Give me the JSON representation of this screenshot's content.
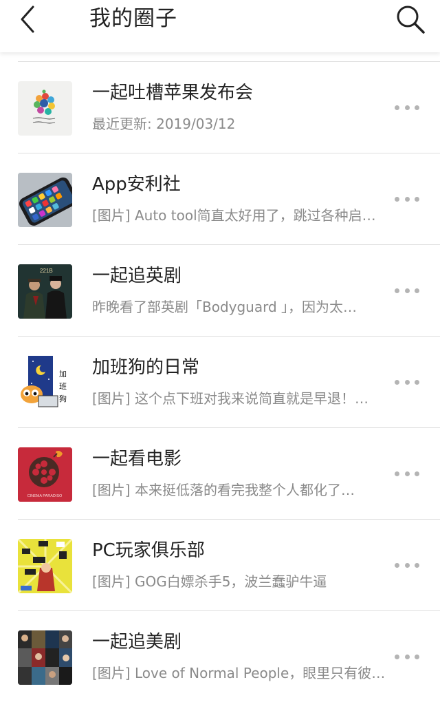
{
  "header": {
    "title": "我的圈子",
    "back_icon": "chevron-left-icon",
    "search_icon": "search-icon"
  },
  "circles": [
    {
      "name": "一起吐槽苹果发布会",
      "subtitle": "最近更新: 2019/03/12",
      "thumb_caption": "There's more in the making",
      "thumb_icon": "apple-logo-icon"
    },
    {
      "name": "App安利社",
      "subtitle": "[图片] Auto tool简直太好用了，跳过各种启…",
      "thumb_icon": "phone-apps-icon"
    },
    {
      "name": "一起追英剧",
      "subtitle": "昨晚看了部英剧「Bodyguard 」，因为太…",
      "thumb_caption": "221B",
      "thumb_icon": "sherlock-poster-icon"
    },
    {
      "name": "加班狗的日常",
      "subtitle": "[图片] 这个点下班对我来说简直就是早退！…",
      "thumb_caption": "加班狗",
      "thumb_icon": "dog-laptop-icon"
    },
    {
      "name": "一起看电影",
      "subtitle": "[图片] 本来挺低落的看完我整个人都化了…",
      "thumb_caption": "CINEMA PARADISO",
      "thumb_icon": "film-reel-icon"
    },
    {
      "name": "PC玩家俱乐部",
      "subtitle": "[图片] GOG白嫖杀手5，波兰蠢驴牛逼",
      "thumb_icon": "sale-tags-icon"
    },
    {
      "name": "一起追美剧",
      "subtitle": "[图片] Love of Normal People，眼里只有彼…",
      "thumb_icon": "poster-collage-icon"
    }
  ],
  "more_icon": "more-dots-icon",
  "colors": {
    "title": "#222222",
    "subtitle": "#8a8a8a",
    "divider": "#dedede",
    "dots": "#b4b4b4"
  }
}
